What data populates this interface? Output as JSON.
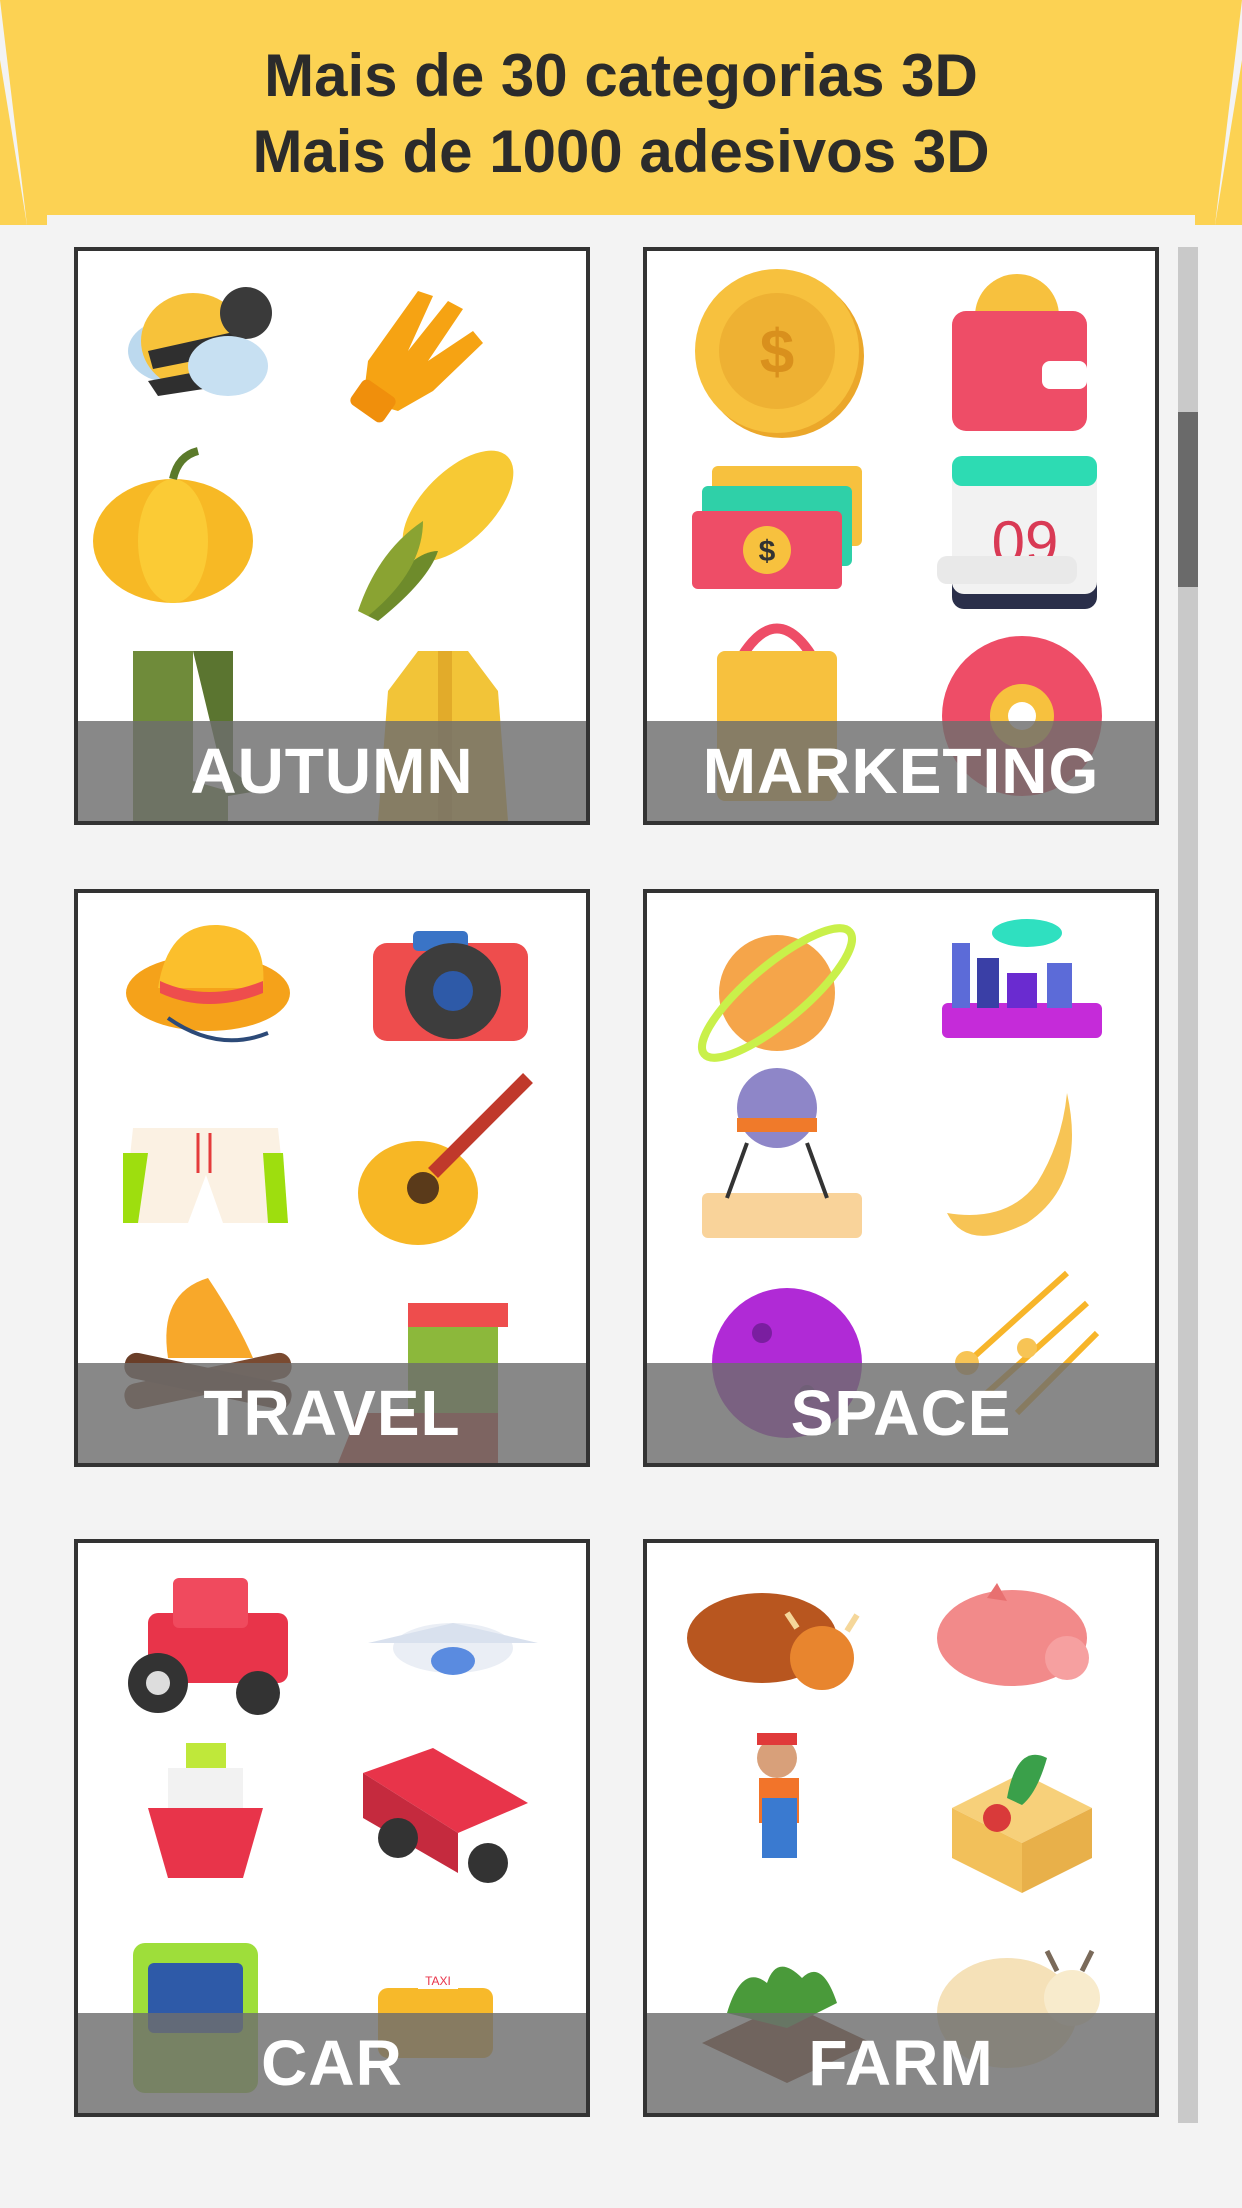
{
  "header": {
    "line1": "Mais de 30 categorias 3D",
    "line2": "Mais de 1000 adesivos 3D",
    "color": "#fcd253"
  },
  "categories": [
    {
      "label": "AUTUMN",
      "icons": [
        "bee-icon",
        "glove-icon",
        "pumpkin-icon",
        "corn-icon",
        "rubber-boots-icon",
        "coat-icon"
      ]
    },
    {
      "label": "MARKETING",
      "icons": [
        "coin-icon",
        "wallet-icon",
        "money-stack-icon",
        "calendar-icon",
        "shopping-bag-icon",
        "gear-icon"
      ]
    },
    {
      "label": "TRAVEL",
      "icons": [
        "sun-hat-icon",
        "camera-icon",
        "swim-shorts-icon",
        "guitar-icon",
        "campfire-icon",
        "boot-icon"
      ]
    },
    {
      "label": "SPACE",
      "icons": [
        "planet-icon",
        "alien-city-icon",
        "lander-icon",
        "moon-icon",
        "purple-planet-icon",
        "shooting-stars-icon"
      ]
    },
    {
      "label": "CAR",
      "icons": [
        "tractor-icon",
        "airplane-icon",
        "ship-icon",
        "pickup-truck-icon",
        "bus-icon",
        "taxi-icon"
      ]
    },
    {
      "label": "FARM",
      "icons": [
        "bull-icon",
        "pig-icon",
        "farmer-icon",
        "vegetable-crate-icon",
        "garden-bed-icon",
        "goat-icon"
      ]
    }
  ],
  "calendar_day": "09",
  "taxi_sign": "TAXI",
  "scrollbar": {
    "position": 0.12
  }
}
